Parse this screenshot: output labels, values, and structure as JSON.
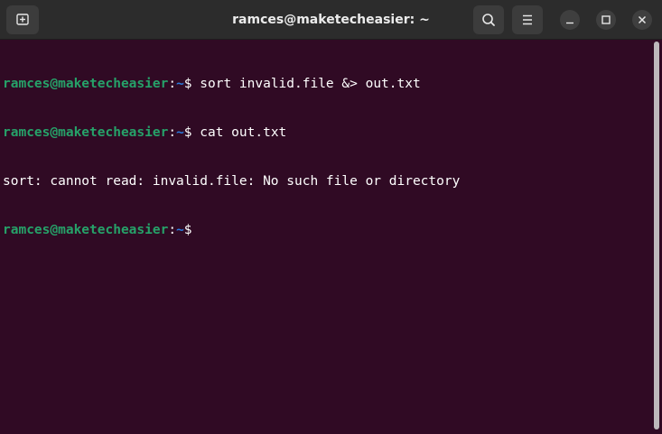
{
  "window": {
    "title": "ramces@maketecheasier: ~"
  },
  "icons": {
    "new_tab": "new-tab-icon",
    "search": "search-icon",
    "menu": "hamburger-menu-icon",
    "minimize": "minimize-icon",
    "maximize": "maximize-icon",
    "close": "close-icon"
  },
  "colors": {
    "background": "#300a24",
    "prompt_user": "#26a269",
    "prompt_path": "#2a7bde",
    "text": "#ffffff"
  },
  "terminal": {
    "lines": [
      {
        "user": "ramces@maketecheasier",
        "colon": ":",
        "path": "~",
        "dollar": "$",
        "command": " sort invalid.file &> out.txt"
      },
      {
        "user": "ramces@maketecheasier",
        "colon": ":",
        "path": "~",
        "dollar": "$",
        "command": " cat out.txt"
      },
      {
        "output": "sort: cannot read: invalid.file: No such file or directory"
      },
      {
        "user": "ramces@maketecheasier",
        "colon": ":",
        "path": "~",
        "dollar": "$",
        "command": ""
      }
    ]
  }
}
